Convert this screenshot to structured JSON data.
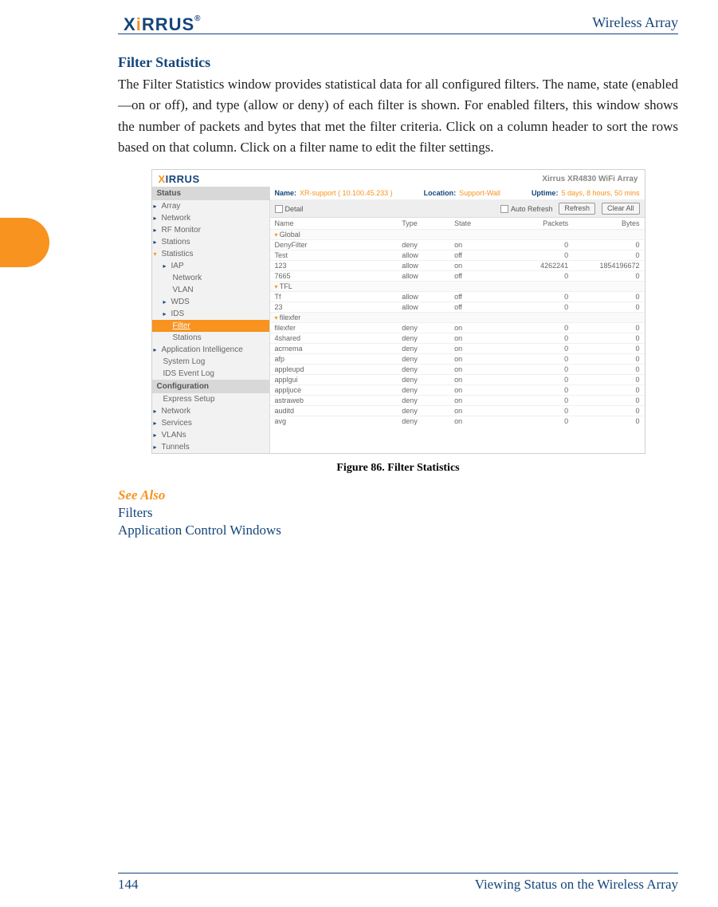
{
  "header": {
    "logo_text": "XIRRUS",
    "doc_title": "Wireless Array"
  },
  "section_title": "Filter Statistics",
  "body_text": "The Filter Statistics window provides statistical data for all configured filters. The name, state (enabled—on or off), and type (allow or deny) of each filter is shown. For enabled filters, this window shows the number of packets and bytes that met the filter criteria. Click on a column header to sort the rows based on that column. Click on a filter name to edit the filter settings.",
  "figure_caption": "Figure 86. Filter Statistics",
  "see_also": {
    "heading": "See Also",
    "links": [
      "Filters",
      "Application Control Windows"
    ]
  },
  "footer": {
    "page": "144",
    "chapter": "Viewing Status on the Wireless Array"
  },
  "screenshot": {
    "model": "Xirrus XR4830 WiFi Array",
    "info": {
      "name_label": "Name:",
      "name_value": "XR-support  ( 10.100.45.233 )",
      "loc_label": "Location:",
      "loc_value": "Support-Wall",
      "up_label": "Uptime:",
      "up_value": "5 days, 8 hours, 50 mins"
    },
    "toolbar": {
      "detail": "Detail",
      "auto": "Auto Refresh",
      "refresh": "Refresh",
      "clear": "Clear All"
    },
    "sidebar": {
      "status": "Status",
      "items_top": [
        "Array",
        "Network",
        "RF Monitor",
        "Stations"
      ],
      "stats": "Statistics",
      "stats_sub": [
        "IAP",
        "Network",
        "VLAN",
        "WDS",
        "IDS"
      ],
      "filter": "Filter",
      "after_filter": [
        "Stations",
        "Application Intelligence",
        "System Log",
        "IDS Event Log"
      ],
      "config": "Configuration",
      "config_items": [
        "Express Setup",
        "Network",
        "Services",
        "VLANs",
        "Tunnels"
      ]
    },
    "columns": [
      "Name",
      "Type",
      "State",
      "Packets",
      "Bytes"
    ],
    "groups": [
      {
        "title": "Global",
        "rows": [
          {
            "name": "DenyFilter",
            "type": "deny",
            "state": "on",
            "packets": "0",
            "bytes": "0"
          },
          {
            "name": "Test",
            "type": "allow",
            "state": "off",
            "packets": "0",
            "bytes": "0"
          },
          {
            "name": "123",
            "type": "allow",
            "state": "on",
            "packets": "4262241",
            "bytes": "1854196672"
          },
          {
            "name": "7665",
            "type": "allow",
            "state": "off",
            "packets": "0",
            "bytes": "0"
          }
        ]
      },
      {
        "title": "TFL",
        "rows": [
          {
            "name": "Tf",
            "type": "allow",
            "state": "off",
            "packets": "0",
            "bytes": "0"
          },
          {
            "name": "23",
            "type": "allow",
            "state": "off",
            "packets": "0",
            "bytes": "0"
          }
        ]
      },
      {
        "title": "filexfer",
        "rows": [
          {
            "name": "filexfer",
            "type": "deny",
            "state": "on",
            "packets": "0",
            "bytes": "0"
          },
          {
            "name": "4shared",
            "type": "deny",
            "state": "on",
            "packets": "0",
            "bytes": "0"
          },
          {
            "name": "acrnema",
            "type": "deny",
            "state": "on",
            "packets": "0",
            "bytes": "0"
          },
          {
            "name": "afp",
            "type": "deny",
            "state": "on",
            "packets": "0",
            "bytes": "0"
          },
          {
            "name": "appleupd",
            "type": "deny",
            "state": "on",
            "packets": "0",
            "bytes": "0"
          },
          {
            "name": "applgui",
            "type": "deny",
            "state": "on",
            "packets": "0",
            "bytes": "0"
          },
          {
            "name": "appljuce",
            "type": "deny",
            "state": "on",
            "packets": "0",
            "bytes": "0"
          },
          {
            "name": "astraweb",
            "type": "deny",
            "state": "on",
            "packets": "0",
            "bytes": "0"
          },
          {
            "name": "auditd",
            "type": "deny",
            "state": "on",
            "packets": "0",
            "bytes": "0"
          },
          {
            "name": "avg",
            "type": "deny",
            "state": "on",
            "packets": "0",
            "bytes": "0"
          }
        ]
      }
    ]
  }
}
